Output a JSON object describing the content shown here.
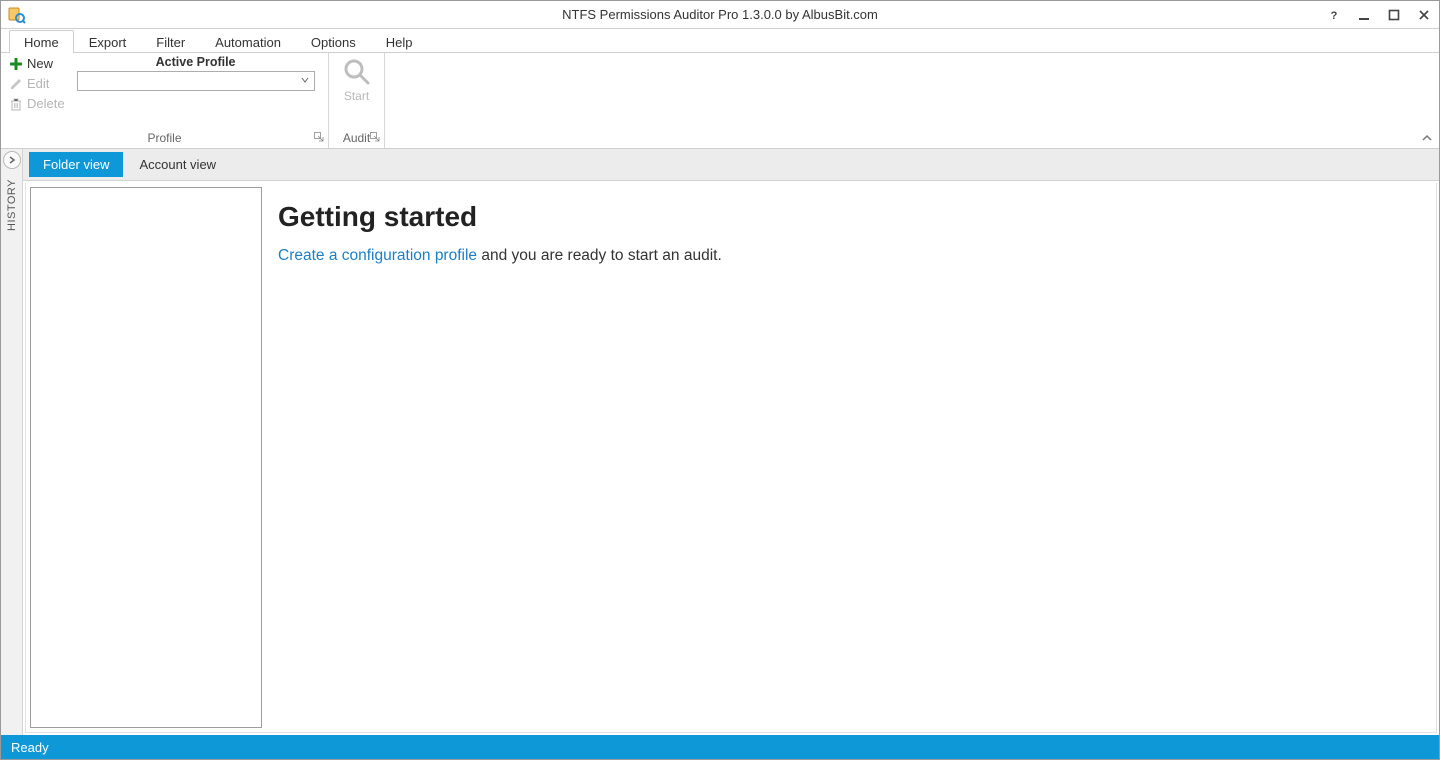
{
  "title": "NTFS Permissions Auditor Pro 1.3.0.0 by AlbusBit.com",
  "ribbon": {
    "tabs": [
      "Home",
      "Export",
      "Filter",
      "Automation",
      "Options",
      "Help"
    ],
    "active_tab": "Home",
    "profile_group": {
      "label": "Profile",
      "new": "New",
      "edit": "Edit",
      "delete": "Delete",
      "active_profile_label": "Active Profile",
      "combo_value": ""
    },
    "audit_group": {
      "label": "Audit",
      "start": "Start"
    }
  },
  "history_label": "HISTORY",
  "view_tabs": {
    "folder": "Folder view",
    "account": "Account view"
  },
  "welcome": {
    "heading": "Getting started",
    "link_text": "Create a configuration profile",
    "rest_text": " and you are ready to start an audit."
  },
  "status": "Ready"
}
